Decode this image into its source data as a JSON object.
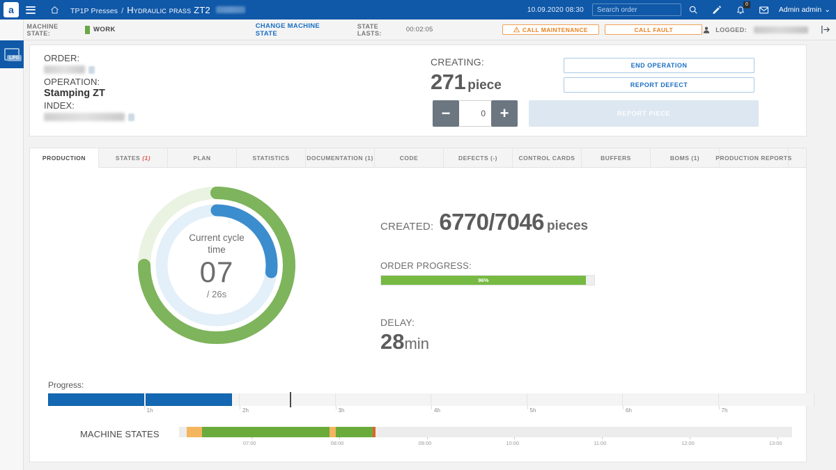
{
  "topbar": {
    "logo_text": "a",
    "breadcrumb_root": "TP1P Presses",
    "breadcrumb_sep": "/",
    "breadcrumb_current": "Hydraulic prass ZT2",
    "datetime": "10.09.2020 08:30",
    "search_placeholder": "Search order",
    "notification_count": "0",
    "user": "Admin admin",
    "user_caret": "⌄"
  },
  "statebar": {
    "machine_state_label": "MACHINE STATE:",
    "machine_state_value": "WORK",
    "machine_state_color": "#6aa844",
    "change_state_link": "CHANGE MACHINE STATE",
    "state_lasts_label": "STATE LASTS:",
    "state_lasts_value": "00:02:05",
    "call_maintenance": "CALL MAINTENANCE",
    "call_fault": "CALL FAULT",
    "logged_label": "LOGGED:",
    "accent_orange": "#e8821e"
  },
  "order": {
    "order_label": "ORDER:",
    "operation_label": "OPERATION:",
    "operation_value": "Stamping ZT",
    "index_label": "INDEX:",
    "creating_label": "CREATING:",
    "creating_value": "271",
    "creating_unit": "piece",
    "stepper_minus": "−",
    "stepper_plus": "+",
    "stepper_value": "0",
    "end_operation": "END OPERATION",
    "report_defect": "REPORT DEFECT",
    "report_piece": "REPORT PIECE"
  },
  "tabs": [
    {
      "label": "PRODUCTION",
      "count": "",
      "active": true
    },
    {
      "label": "STATES",
      "count": "(1)",
      "active": false
    },
    {
      "label": "PLAN",
      "count": "",
      "active": false
    },
    {
      "label": "STATISTICS",
      "count": "",
      "active": false
    },
    {
      "label": "DOCUMENTATION (1)",
      "count": "",
      "active": false
    },
    {
      "label": "CODE",
      "count": "",
      "active": false
    },
    {
      "label": "DEFECTS (-)",
      "count": "",
      "active": false
    },
    {
      "label": "CONTROL CARDS",
      "count": "",
      "active": false
    },
    {
      "label": "BUFFERS",
      "count": "",
      "active": false
    },
    {
      "label": "BOMS (1)",
      "count": "",
      "active": false
    },
    {
      "label": "PRODUCTION REPORTS",
      "count": "",
      "active": false
    }
  ],
  "production": {
    "cycle_title_line1": "Current cycle",
    "cycle_title_line2": "time",
    "cycle_value": "07",
    "cycle_target": "/ 26s",
    "created_label": "CREATED:",
    "created_value": "6770/7046",
    "created_unit": "pieces",
    "order_progress_label": "ORDER PROGRESS:",
    "order_progress_value": "96%",
    "delay_label": "DELAY:",
    "delay_value": "28",
    "delay_unit": "min",
    "progress_label": "Progress:",
    "machine_states_label": "MACHINE STATES"
  },
  "chart_data": [
    {
      "type": "pie",
      "title": "Current cycle time",
      "name": "cycle-donut-outer",
      "ring": "outer",
      "color": "#7eb45c",
      "track_color": "#eaf3e2",
      "value_pct": 75,
      "values": [
        75,
        25
      ],
      "categories": [
        "elapsed",
        "remaining"
      ]
    },
    {
      "type": "pie",
      "title": "Current cycle time",
      "name": "cycle-donut-inner",
      "ring": "inner",
      "color": "#3c8dcd",
      "track_color": "#e3eff9",
      "value_pct": 27,
      "values": [
        27,
        73
      ],
      "categories": [
        "elapsed",
        "remaining"
      ],
      "annotation": "07 / 26s"
    },
    {
      "type": "bar",
      "name": "order-progress-bar",
      "title": "ORDER PROGRESS",
      "categories": [
        "progress"
      ],
      "values": [
        96
      ],
      "ylim": [
        0,
        100
      ],
      "color": "#76b943",
      "label": "96%"
    },
    {
      "type": "bar",
      "name": "progress-timeline",
      "title": "Progress",
      "xlabel": "hours",
      "tick_labels": [
        "1h",
        "2h",
        "3h",
        "4h",
        "5h",
        "6h",
        "7h"
      ],
      "xlim": [
        0,
        8
      ],
      "grid": true,
      "color": "#1468b3",
      "blocks": [
        {
          "start_h": 0.0,
          "end_h": 1.0
        },
        {
          "start_h": 1.02,
          "end_h": 1.92
        }
      ],
      "marker_h": 2.52
    },
    {
      "type": "bar",
      "name": "machine-states-timeline",
      "title": "MACHINE STATES",
      "xlabel": "time of day",
      "tick_labels": [
        "07:00",
        "08:00",
        "09:00",
        "10:00",
        "11:00",
        "12:00",
        "13:00"
      ],
      "segments": [
        {
          "state": "idle",
          "color": "#f5b55e",
          "start_pct": 1.2,
          "end_pct": 3.7
        },
        {
          "state": "work",
          "color": "#6aab3c",
          "start_pct": 3.7,
          "end_pct": 24.6
        },
        {
          "state": "idle",
          "color": "#f5b55e",
          "start_pct": 24.6,
          "end_pct": 25.6
        },
        {
          "state": "work",
          "color": "#6aab3c",
          "start_pct": 25.6,
          "end_pct": 31.6
        },
        {
          "state": "fault",
          "color": "#e2622c",
          "start_pct": 31.6,
          "end_pct": 32.0
        },
        {
          "state": "off",
          "color": "#ececec",
          "start_pct": 32.0,
          "end_pct": 100
        }
      ]
    }
  ],
  "rail": {
    "search_icon": "search-icon",
    "tile_badge": "LPG"
  }
}
